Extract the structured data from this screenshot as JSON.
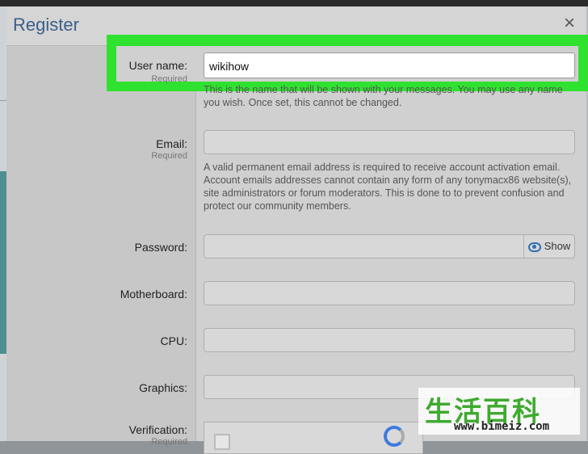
{
  "dialog": {
    "title": "Register",
    "close_icon": "close-icon"
  },
  "fields": {
    "username": {
      "label": "User name:",
      "required": "Required",
      "value": "wikihow",
      "hint": "This is the name that will be shown with your messages. You may use any name you wish. Once set, this cannot be changed."
    },
    "email": {
      "label": "Email:",
      "required": "Required",
      "value": "",
      "hint": "A valid permanent email address is required to receive account activation email. Account emails addresses cannot contain any form of any tonymacx86 website(s), site administrators or forum moderators. This is done to to prevent confusion and protect our community members."
    },
    "password": {
      "label": "Password:",
      "value": "",
      "show_label": "Show",
      "show_icon": "eye-icon"
    },
    "motherboard": {
      "label": "Motherboard:",
      "value": ""
    },
    "cpu": {
      "label": "CPU:",
      "value": ""
    },
    "graphics": {
      "label": "Graphics:",
      "value": ""
    },
    "verification": {
      "label": "Verification:",
      "required": "Required"
    }
  },
  "watermark": {
    "chars": "生活百科",
    "url": "www.bimeiz.com"
  },
  "colors": {
    "highlight": "#2fe22f",
    "title": "#3d5f8a",
    "accent": "#2f6fb0"
  }
}
